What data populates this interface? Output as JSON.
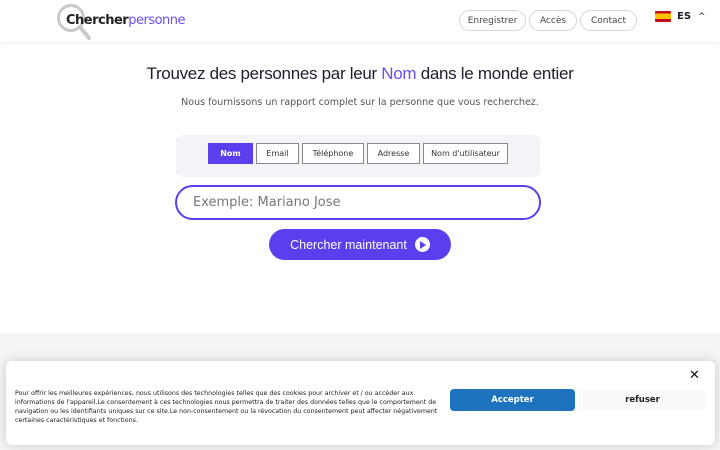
{
  "header": {
    "logo": {
      "part1": "Chercher",
      "part2": "personne"
    },
    "nav": [
      {
        "label": "Enregistrer"
      },
      {
        "label": "Accès"
      },
      {
        "label": "Contact"
      }
    ],
    "language": "ES"
  },
  "hero": {
    "title_before": "Trouvez des personnes par leur ",
    "title_highlight": "Nom",
    "title_after": " dans le monde entier",
    "subtitle": "Nous fournissons un rapport complet sur la personne que vous recherchez."
  },
  "tabs": [
    {
      "label": "Nom",
      "active": true
    },
    {
      "label": "Email",
      "active": false
    },
    {
      "label": "Téléphone",
      "active": false
    },
    {
      "label": "Adresse",
      "active": false
    },
    {
      "label": "Nom d'utilisateur",
      "active": false
    }
  ],
  "search": {
    "placeholder": "Exemple: Mariano Jose",
    "value": ""
  },
  "cta": {
    "label": "Chercher maintenant",
    "icon": "play-circle-icon"
  },
  "cookie": {
    "text": "Pour offrir les meilleures expériences, nous utilisons des technologies telles que des cookies pour archiver et / ou accéder aux informations de l'appareil.Le consentement à ces technologies nous permettra de traiter des données telles que le comportement de navigation ou les identifiants uniques sur ce site.Le non-consentement ou la révocation du consentement peut affecter négativement certaines caractéristiques et fonctions.",
    "accept_label": "Accepter",
    "refuse_label": "refuser",
    "close_glyph": "✕"
  },
  "colors": {
    "brand": "#5b3fef",
    "accept": "#1e73be"
  }
}
